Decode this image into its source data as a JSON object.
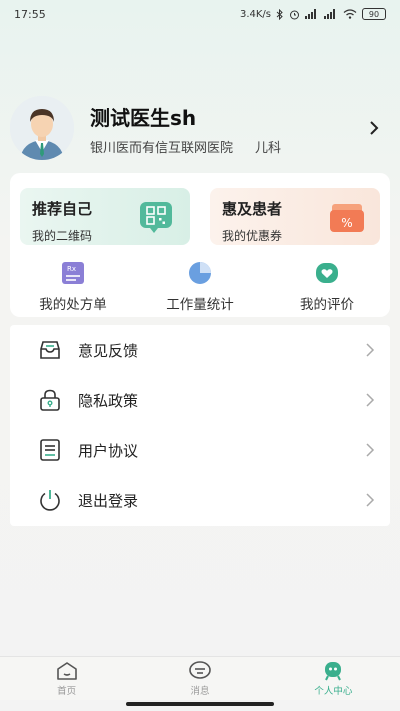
{
  "status_bar": {
    "time": "17:55",
    "network_speed": "3.4K/s",
    "battery": "90"
  },
  "profile": {
    "name": "测试医生sh",
    "hospital": "银川医而有信互联网医院",
    "department": "儿科"
  },
  "promos": [
    {
      "title": "推荐自己",
      "subtitle": "我的二维码",
      "icon": "qr-code-icon"
    },
    {
      "title": "惠及患者",
      "subtitle": "我的优惠券",
      "icon": "coupon-icon"
    }
  ],
  "quick_actions": [
    {
      "label": "我的处方单",
      "icon": "prescription-icon"
    },
    {
      "label": "工作量统计",
      "icon": "pie-chart-icon"
    },
    {
      "label": "我的评价",
      "icon": "heart-icon"
    }
  ],
  "menu": [
    {
      "label": "意见反馈",
      "icon": "feedback-icon"
    },
    {
      "label": "隐私政策",
      "icon": "lock-icon"
    },
    {
      "label": "用户协议",
      "icon": "agreement-icon"
    },
    {
      "label": "退出登录",
      "icon": "power-icon"
    }
  ],
  "bottom_nav": [
    {
      "label": "首页",
      "icon": "home-icon"
    },
    {
      "label": "消息",
      "icon": "message-icon"
    },
    {
      "label": "个人中心",
      "icon": "profile-icon",
      "active": true
    }
  ],
  "colors": {
    "accent": "#3aaf8d",
    "promo_green": "#d8efe6",
    "promo_orange": "#f9e6db"
  }
}
